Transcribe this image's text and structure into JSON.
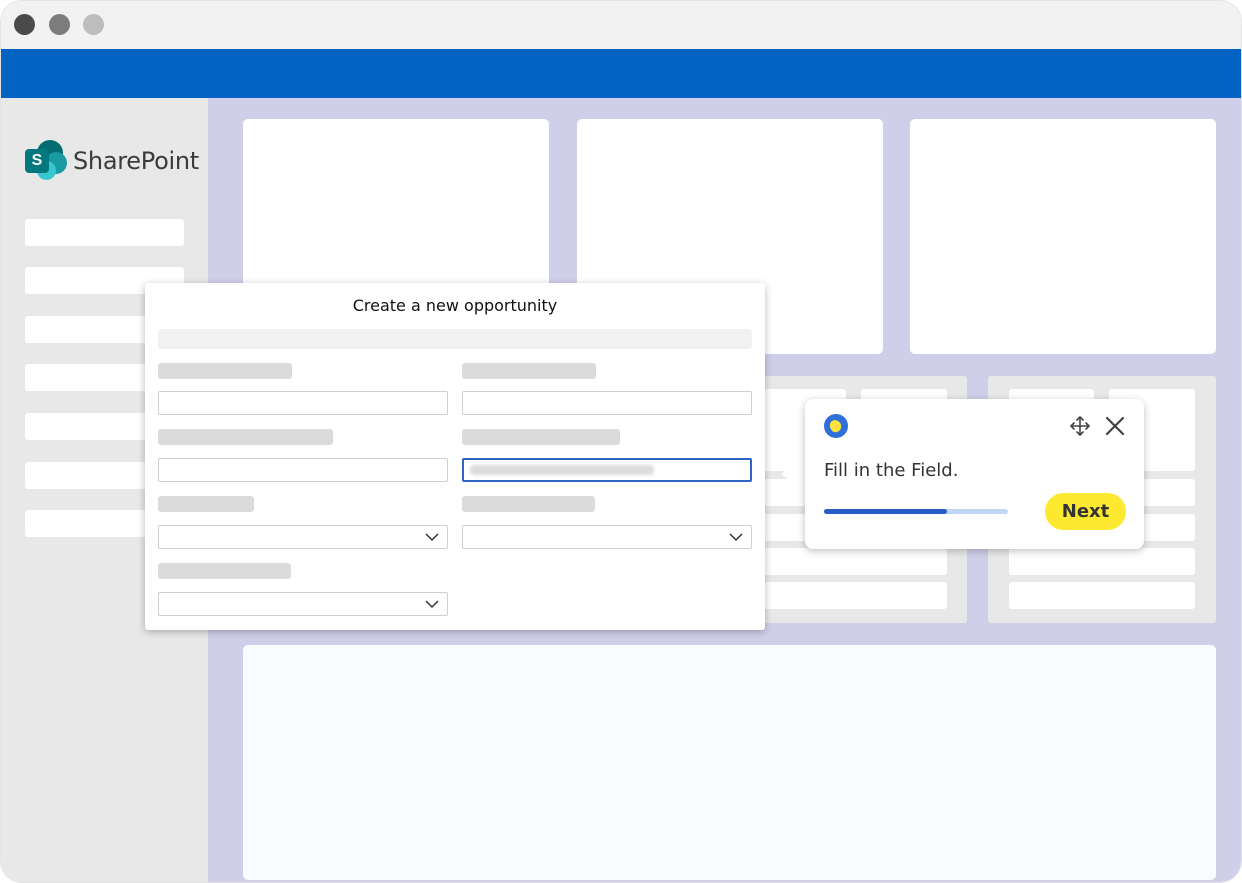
{
  "app": {
    "brand_name": "SharePoint",
    "logo_letter": "S"
  },
  "dialog": {
    "title": "Create a new opportunity"
  },
  "guide_tip": {
    "message": "Fill in the Field.",
    "next_label": "Next",
    "progress_fraction": 0.67
  },
  "colors": {
    "top_bar": "#0363c2",
    "content_bg": "#cfcfe9",
    "accent_button": "#fde92f",
    "progress": "#2a5cc8",
    "focused_field_border": "#2f64c4"
  },
  "icons": [
    "sharepoint-logo-icon",
    "whatfix-lemon-icon",
    "move-icon",
    "close-icon",
    "chevron-down-icon"
  ]
}
